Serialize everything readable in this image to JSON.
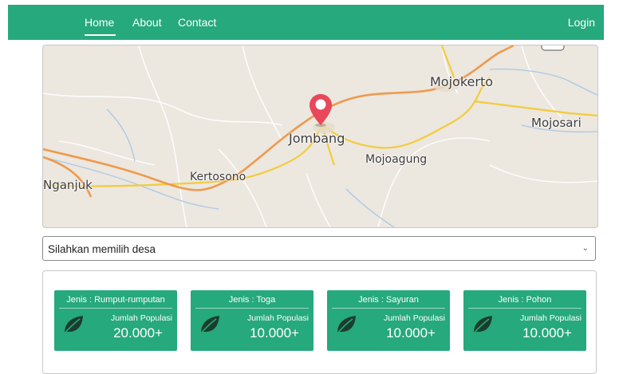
{
  "nav": {
    "home": "Home",
    "about": "About",
    "contact": "Contact",
    "login": "Login"
  },
  "map": {
    "places": {
      "mojokerto": "Mojokerto",
      "mojosari": "Mojosari",
      "jombang": "Jombang",
      "mojoagung": "Mojoagung",
      "kertosono": "Kertosono",
      "nganjuk": "Nganjuk"
    }
  },
  "select": {
    "value": "Silahkan memilih desa"
  },
  "cards": [
    {
      "title": "Jenis : Rumput-rumputan",
      "label": "Jumlah Populasi",
      "count": "20.000+"
    },
    {
      "title": "Jenis : Toga",
      "label": "Jumlah Populasi",
      "count": "10.000+"
    },
    {
      "title": "Jenis : Sayuran",
      "label": "Jumlah Populasi",
      "count": "10.000+"
    },
    {
      "title": "Jenis : Pohon",
      "label": "Jumlah Populasi",
      "count": "10.000+"
    }
  ],
  "colors": {
    "brand": "#26a97c",
    "marker": "#e8485a"
  }
}
